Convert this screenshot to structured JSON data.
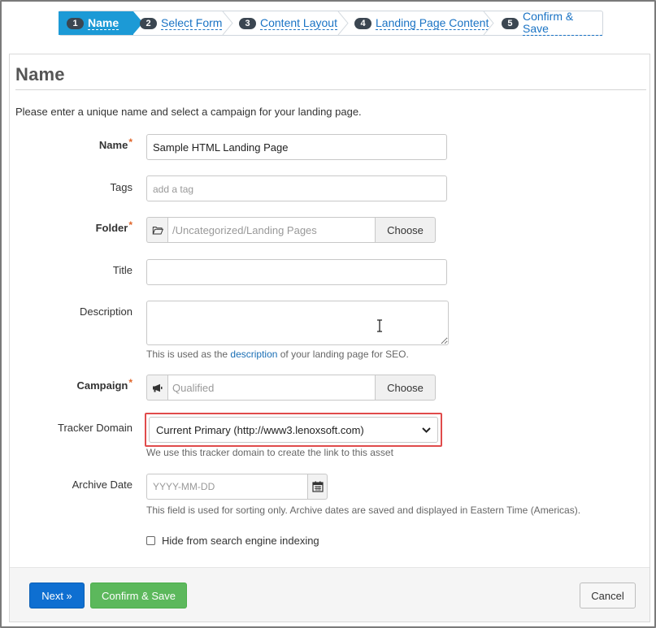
{
  "wizard": {
    "steps": [
      {
        "num": "1",
        "label": "Name",
        "active": true
      },
      {
        "num": "2",
        "label": "Select Form"
      },
      {
        "num": "3",
        "label": "Content Layout"
      },
      {
        "num": "4",
        "label": "Landing Page Content"
      },
      {
        "num": "5",
        "label": "Confirm & Save"
      }
    ]
  },
  "page": {
    "title": "Name",
    "intro": "Please enter a unique name and select a campaign for your landing page."
  },
  "form": {
    "name": {
      "label": "Name",
      "required_mark": "*",
      "value": "Sample HTML Landing Page"
    },
    "tags": {
      "label": "Tags",
      "placeholder": "add a tag"
    },
    "folder": {
      "label": "Folder",
      "required_mark": "*",
      "value": "/Uncategorized/Landing Pages",
      "button": "Choose",
      "icon": "folder-open-icon"
    },
    "title": {
      "label": "Title",
      "value": ""
    },
    "description": {
      "label": "Description",
      "value": "",
      "help_prefix": "This is used as the ",
      "help_link": "description",
      "help_suffix": " of your landing page for SEO."
    },
    "campaign": {
      "label": "Campaign",
      "required_mark": "*",
      "value": "Qualified",
      "button": "Choose",
      "icon": "megaphone-icon"
    },
    "tracker_domain": {
      "label": "Tracker Domain",
      "value": "Current Primary (http://www3.lenoxsoft.com)",
      "help": "We use this tracker domain to create the link to this asset"
    },
    "archive_date": {
      "label": "Archive Date",
      "placeholder": "YYYY-MM-DD",
      "icon": "calendar-icon",
      "help": "This field is used for sorting only. Archive dates are saved and displayed in Eastern Time (Americas)."
    },
    "hide_from_search": {
      "label": "Hide from search engine indexing",
      "checked": false
    }
  },
  "footer": {
    "next": "Next »",
    "confirm": "Confirm & Save",
    "cancel": "Cancel"
  },
  "colors": {
    "active_step": "#1c9ad6",
    "link": "#1a73c4",
    "next_button": "#0e6fd1",
    "confirm_button": "#5cb85c",
    "highlight_border": "#e04b4b",
    "required_star": "#e0662b"
  }
}
